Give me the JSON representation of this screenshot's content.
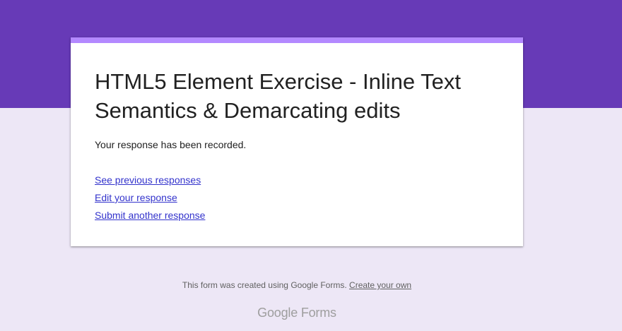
{
  "form": {
    "title": "HTML5 Element Exercise - Inline Text Semantics & Demarcating edits",
    "confirmation_message": "Your response has been recorded.",
    "links": {
      "previous_responses": "See previous responses",
      "edit_response": "Edit your response",
      "submit_another": "Submit another response"
    }
  },
  "footer": {
    "created_text": "This form was created using Google Forms.",
    "create_link": "Create your own",
    "brand_google": "Google",
    "brand_forms": "Forms"
  },
  "colors": {
    "header_band": "#673ab7",
    "page_background": "#ede7f6",
    "card_accent": "#b388ff",
    "link": "#3333cc"
  }
}
